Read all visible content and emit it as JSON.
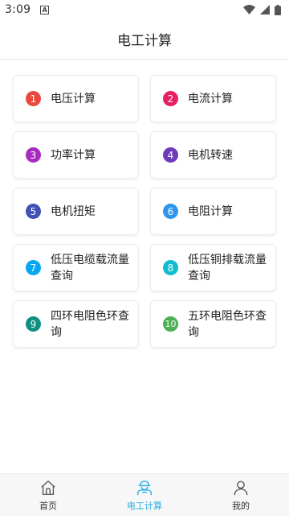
{
  "status": {
    "time": "3:09",
    "notif_letter": "A"
  },
  "header": {
    "title": "电工计算"
  },
  "cards": [
    {
      "num": "1",
      "label": "电压计算",
      "color": "#e8493e"
    },
    {
      "num": "2",
      "label": "电流计算",
      "color": "#e81f63"
    },
    {
      "num": "3",
      "label": "功率计算",
      "color": "#a82cbf"
    },
    {
      "num": "4",
      "label": "电机转速",
      "color": "#6d3bb8"
    },
    {
      "num": "5",
      "label": "电机扭矩",
      "color": "#3f51b5"
    },
    {
      "num": "6",
      "label": "电阻计算",
      "color": "#2f96ee"
    },
    {
      "num": "7",
      "label": "低压电缆载流量查询",
      "color": "#06a9f1"
    },
    {
      "num": "8",
      "label": "低压铜排载流量查询",
      "color": "#10bccf"
    },
    {
      "num": "9",
      "label": "四环电阻色环查询",
      "color": "#0e9183"
    },
    {
      "num": "10",
      "label": "五环电阻色环查询",
      "color": "#4caf50"
    }
  ],
  "nav": [
    {
      "label": "首页",
      "icon": "home-icon"
    },
    {
      "label": "电工计算",
      "icon": "electrician-icon",
      "active_color": "#29aee6"
    },
    {
      "label": "我的",
      "icon": "user-icon"
    }
  ]
}
